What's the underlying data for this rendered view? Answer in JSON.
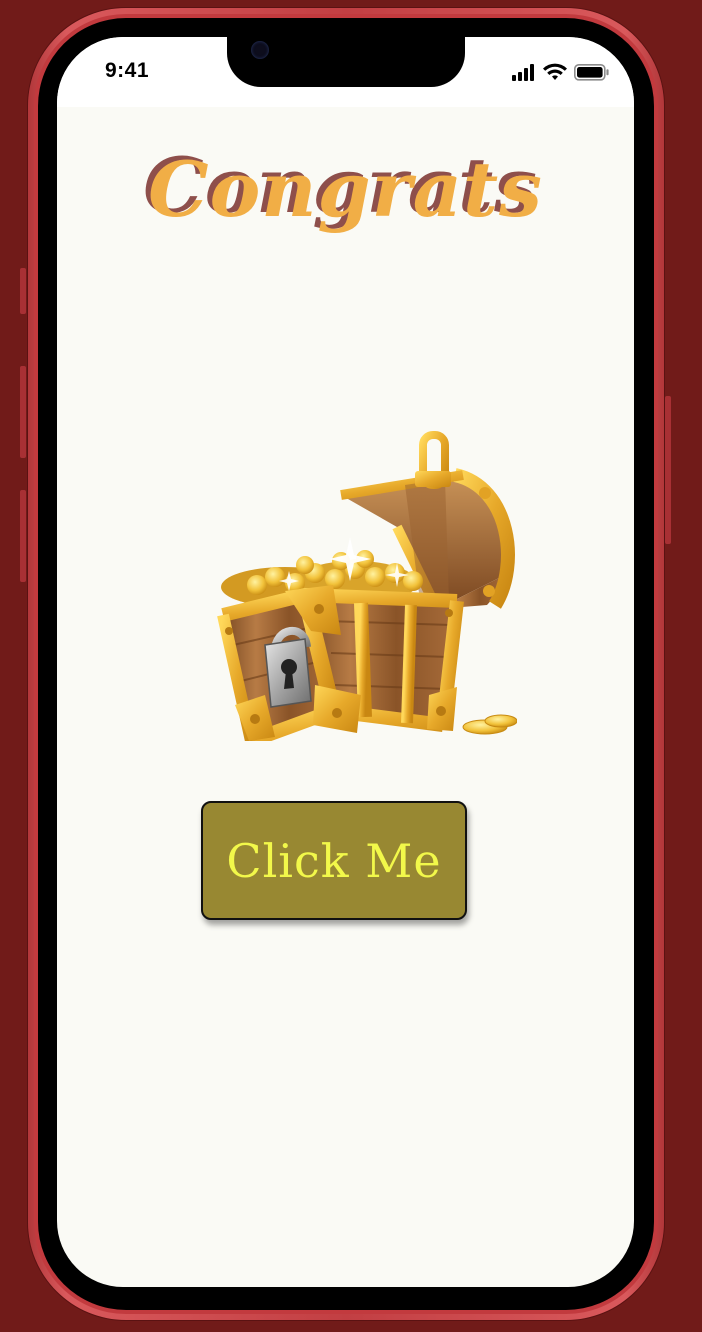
{
  "status_bar": {
    "time": "9:41",
    "icons": [
      "cellular-signal-icon",
      "wifi-icon",
      "battery-icon"
    ]
  },
  "screen": {
    "title": "Congrats",
    "image": "treasure-chest-icon",
    "button_label": "Click Me"
  },
  "colors": {
    "background": "#711b19",
    "phone_frame": "#c23f43",
    "screen": "#fafaf5",
    "title_fill": "#f1ae46",
    "title_shadow": "#8e4f4b",
    "button_fill": "#988832",
    "button_text": "#f2f84a"
  }
}
